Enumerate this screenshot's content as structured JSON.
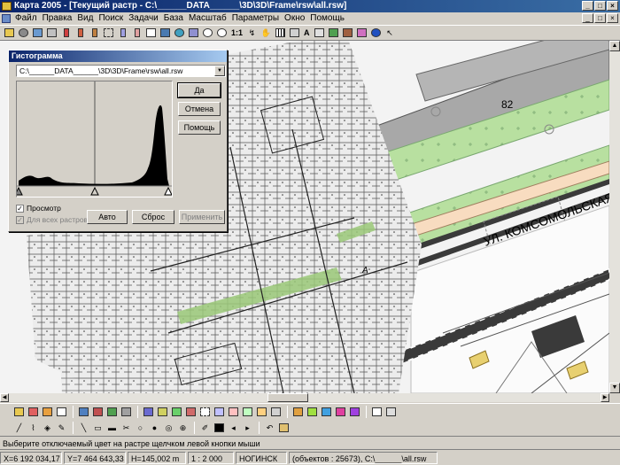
{
  "window": {
    "title": "Карта 2005 - [Текущий растр - C:\\______DATA______\\3D\\3D\\Frame\\rsw\\all.rsw]",
    "controls": [
      "_",
      "□",
      "×"
    ]
  },
  "menu": [
    "Файл",
    "Правка",
    "Вид",
    "Поиск",
    "Задачи",
    "База",
    "Масштаб",
    "Параметры",
    "Окно",
    "Помощь"
  ],
  "toolbar_top": {
    "zoom_label": "1:1",
    "text_tool": "A"
  },
  "map": {
    "street_label": "УЛ. КОМСОМОЛЬСКАЯ",
    "building_number": "82",
    "block_label": "А",
    "colors": {
      "background": "#f3f3f3",
      "building": "#a8a8a8",
      "green": "#b8e0a0",
      "road": "#f8dcc0",
      "rail": "#3a3a3a",
      "highlight": "#e8d070"
    }
  },
  "dialog": {
    "title": "Гистограмма",
    "file_path": "C:\\______DATA______\\3D\\3D\\Frame\\rsw\\all.rsw",
    "buttons": {
      "ok": "Да",
      "cancel": "Отмена",
      "help": "Помощь",
      "auto": "Авто",
      "reset": "Сброс",
      "apply": "Применить"
    },
    "checkboxes": {
      "preview": "Просмотр",
      "preview_checked": true,
      "all_rasters": "Для всех растров",
      "all_rasters_checked": true
    }
  },
  "hint": "Выберите отключаемый цвет на растре щелчком левой кнопки мыши",
  "status": {
    "x": "X=6 192 034,17 m",
    "y": "Y=7 464 643,33 m",
    "h": "H=145,002 m",
    "scale": "1 : 2 000",
    "map_name": "НОГИНСК",
    "objects": "(объектов : 25673), C:\\______\\all.rsw"
  }
}
